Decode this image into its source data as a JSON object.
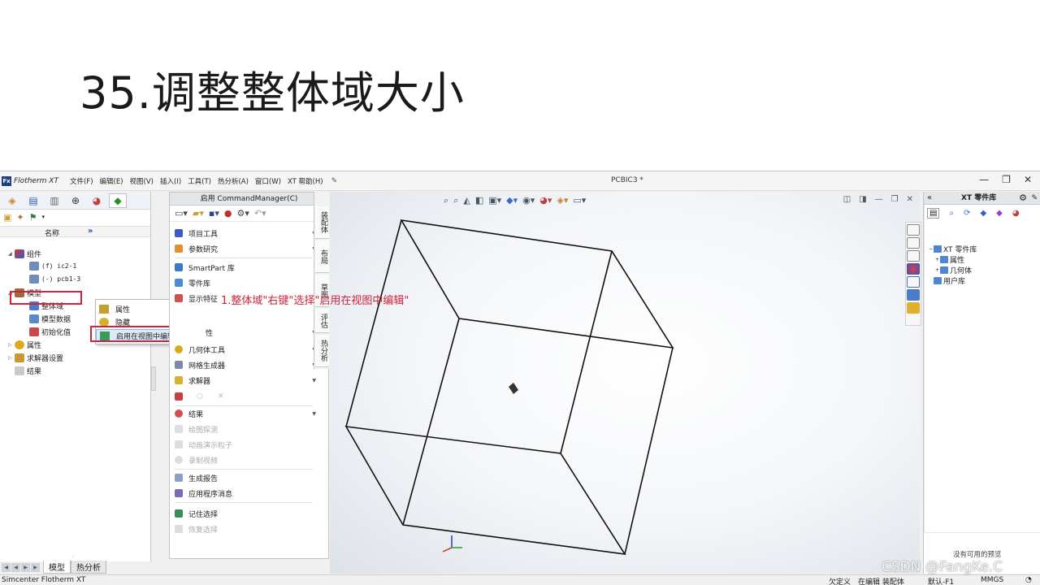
{
  "slide": {
    "title": "35.调整整体域大小"
  },
  "app": {
    "logo_abbr": "Fx",
    "logo_text": "Flotherm XT",
    "menus": [
      "文件(F)",
      "编辑(E)",
      "视图(V)",
      "插入(I)",
      "工具(T)",
      "热分析(A)",
      "窗口(W)",
      "XT 帮助(H)"
    ],
    "document_title": "PCBIC3 *",
    "window_controls": [
      "—",
      "❐",
      "✕"
    ]
  },
  "tree": {
    "column_name": "名称",
    "expand_arrows": "»",
    "nodes": {
      "assembly": "组件",
      "ic": "(f) ic2-1",
      "pcb": "(-) pcb1-3",
      "model": "模型",
      "domain": "整体域",
      "model_data": "模型数据",
      "init": "初始化值",
      "attributes": "属性",
      "solver": "求解器设置",
      "results": "结果"
    },
    "bottom_tabs": [
      "模型",
      "热分析"
    ]
  },
  "context_menu": {
    "items": [
      "属性",
      "隐藏",
      "启用在视图中编辑"
    ]
  },
  "command_manager": {
    "header": "启用 CommandManager(C)",
    "rows": {
      "project_tools": "项目工具",
      "param_study": "参数研究",
      "smartpart": "SmartPart 库",
      "parts_lib": "零件库",
      "display": "显示特征",
      "attributes_partial": "性",
      "geometry_tools": "几何体工具",
      "mesh_gen": "网格生成器",
      "solver": "求解器",
      "results": "结果",
      "plot_probe": "绘图探测",
      "anim_particles": "动画演示粒子",
      "record_video": "录制视频",
      "gen_report": "生成报告",
      "app_messages": "应用程序消息",
      "remember_sel": "记住选择",
      "restore_sel": "恢复选择"
    },
    "side_tabs": [
      "装配体",
      "布局",
      "草图",
      "评估",
      "热分析"
    ]
  },
  "viewport": {
    "annotation": "1.整体域\"右键\"选择\"启用在视图中编辑\""
  },
  "library": {
    "title": "XT 零件库",
    "collapse": "«",
    "nodes": {
      "xt_lib": "XT 零件库",
      "attributes": "属性",
      "geometry": "几何体",
      "user_lib": "用户库"
    },
    "no_preview": "没有可用的预览"
  },
  "status_bar": {
    "app_name": "Simcenter Flotherm XT",
    "underdefined": "欠定义",
    "editing": "在编辑 装配体",
    "default": "默认-F1",
    "units": "MMGS"
  },
  "watermark": "CSDN @FangKe.C",
  "colors": {
    "highlight_red": "#d0243a",
    "accent_blue": "#1b4aa8"
  }
}
